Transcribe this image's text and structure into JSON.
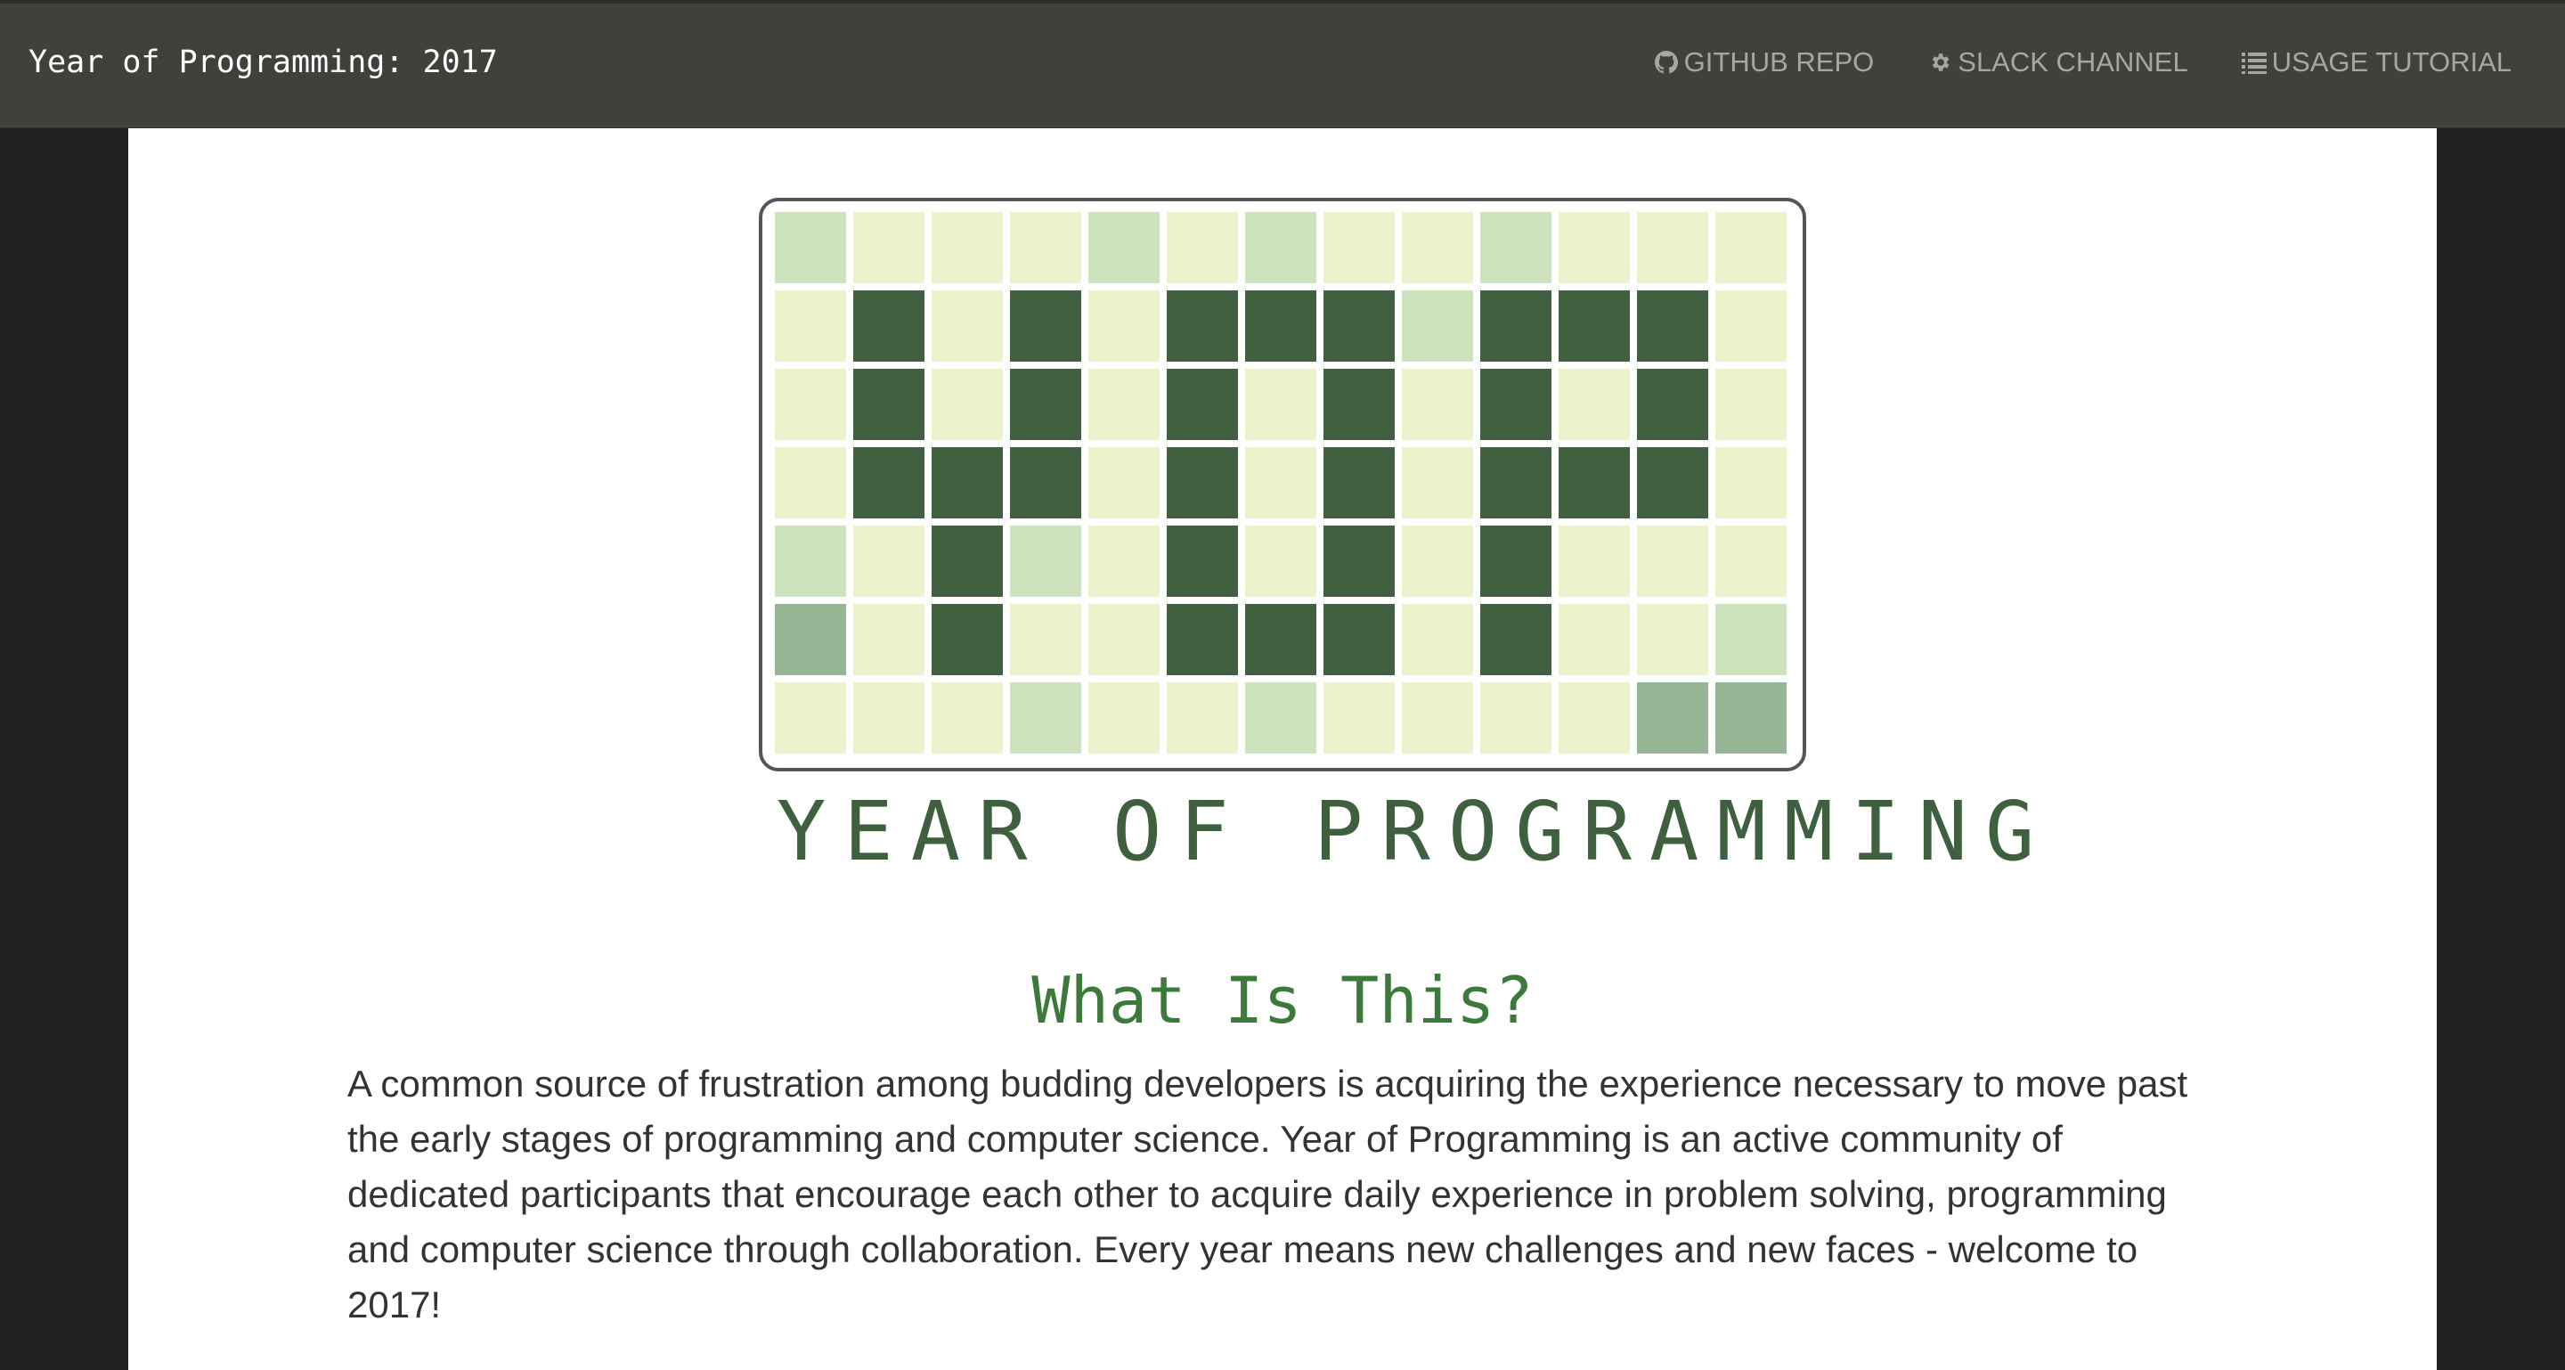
{
  "navbar": {
    "brand": "Year of Programming: 2017",
    "links": [
      {
        "label": "GITHUB REPO",
        "icon": "github-icon"
      },
      {
        "label": "SLACK CHANNEL",
        "icon": "gear-icon"
      },
      {
        "label": "USAGE TUTORIAL",
        "icon": "list-icon"
      }
    ]
  },
  "logo": {
    "text": "YEAR OF PROGRAMMING",
    "palette": [
      "#ecf2cc",
      "#cce3bd",
      "#98b596",
      "#426140"
    ],
    "grid": [
      [
        1,
        0,
        0,
        0,
        1,
        0,
        1,
        0,
        0,
        1,
        0,
        0,
        0
      ],
      [
        0,
        3,
        0,
        3,
        0,
        3,
        3,
        3,
        1,
        3,
        3,
        3,
        0
      ],
      [
        0,
        3,
        0,
        3,
        0,
        3,
        0,
        3,
        0,
        3,
        0,
        3,
        0
      ],
      [
        0,
        3,
        3,
        3,
        0,
        3,
        0,
        3,
        0,
        3,
        3,
        3,
        0
      ],
      [
        1,
        0,
        3,
        1,
        0,
        3,
        0,
        3,
        0,
        3,
        0,
        0,
        0
      ],
      [
        2,
        0,
        3,
        0,
        0,
        3,
        3,
        3,
        0,
        3,
        0,
        0,
        1
      ],
      [
        0,
        0,
        0,
        1,
        0,
        0,
        1,
        0,
        0,
        0,
        0,
        2,
        2
      ]
    ]
  },
  "section": {
    "title": "What Is This?",
    "body": "A common source of frustration among budding developers is acquiring the experience necessary to move past the early stages of programming and computer science. Year of Programming is an active community of dedicated participants that encourage each other to acquire daily experience in problem solving, programming and computer science through collaboration. Every year means new challenges and new faces - welcome to 2017!"
  }
}
